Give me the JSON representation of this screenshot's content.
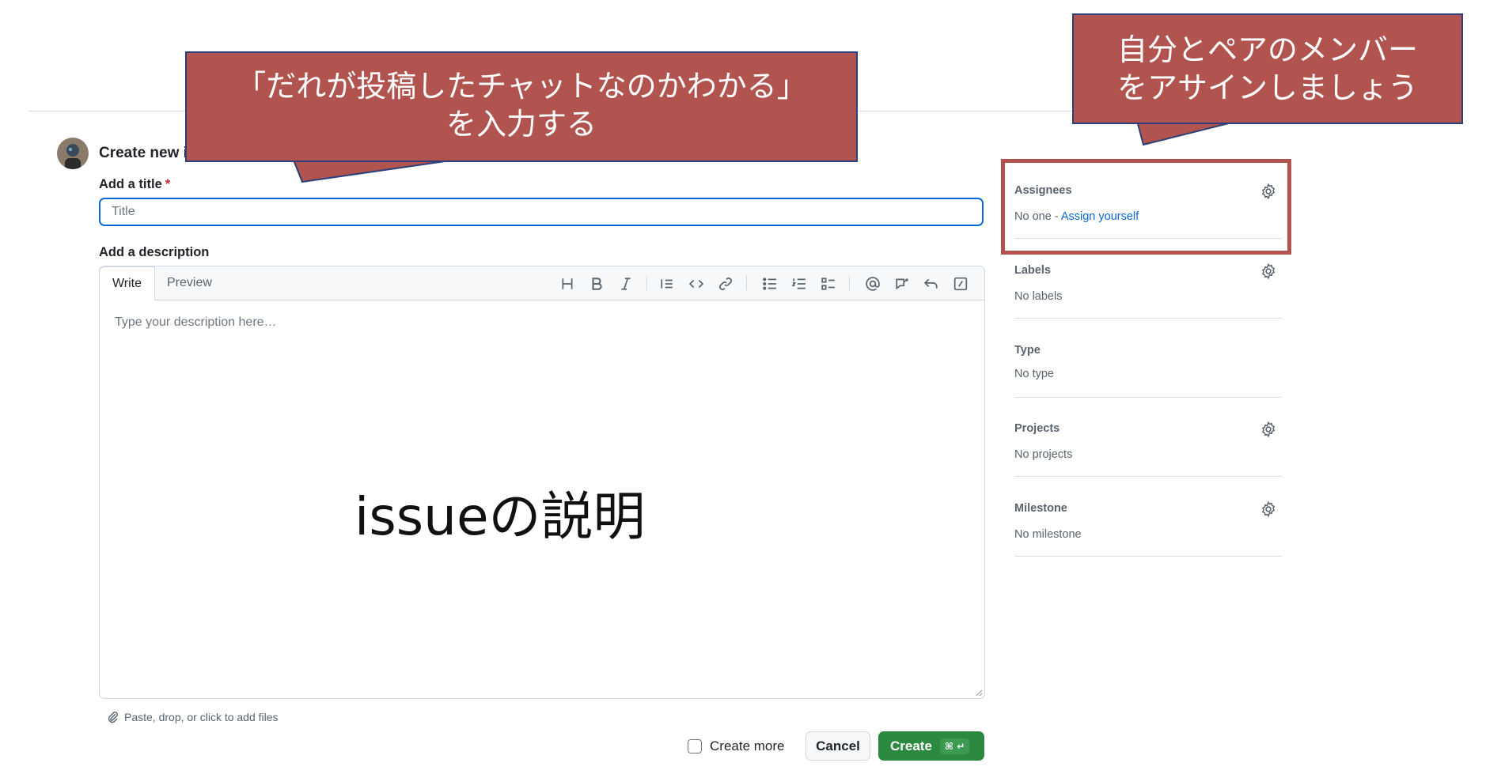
{
  "page": {
    "title": "Create new i",
    "title_label": "Add a title",
    "required_mark": "*",
    "title_placeholder": "Title",
    "description_label": "Add a description"
  },
  "editor": {
    "tabs": [
      {
        "label": "Write",
        "active": true
      },
      {
        "label": "Preview",
        "active": false
      }
    ],
    "toolbar_icons": [
      "heading-icon",
      "bold-icon",
      "italic-icon",
      "quote-icon",
      "code-icon",
      "link-icon",
      "bulleted-list-icon",
      "numbered-list-icon",
      "task-list-icon",
      "mention-icon",
      "reference-icon",
      "undo-icon",
      "slash-command-icon"
    ],
    "placeholder": "Type your description here…"
  },
  "attach": {
    "text": "Paste, drop, or click to add files"
  },
  "actions": {
    "create_more_label": "Create more",
    "create_more_checked": false,
    "cancel_label": "Cancel",
    "create_label": "Create",
    "create_shortcut": "⌘ ↵"
  },
  "sidebar": {
    "assignees": {
      "title": "Assignees",
      "value": "No one - ",
      "link": "Assign yourself"
    },
    "labels": {
      "title": "Labels",
      "value": "No labels"
    },
    "type": {
      "title": "Type",
      "value": "No type"
    },
    "projects": {
      "title": "Projects",
      "value": "No projects"
    },
    "milestone": {
      "title": "Milestone",
      "value": "No milestone"
    }
  },
  "annotations": {
    "title_callout_line1": "「だれが投稿したチャットなのかわかる」",
    "title_callout_line2": "を入力する",
    "assignee_callout_line1": "自分とペアのメンバー",
    "assignee_callout_line2": "をアサインしましょう",
    "description_note": "issueの説明",
    "accent_color": "#b1544f"
  }
}
